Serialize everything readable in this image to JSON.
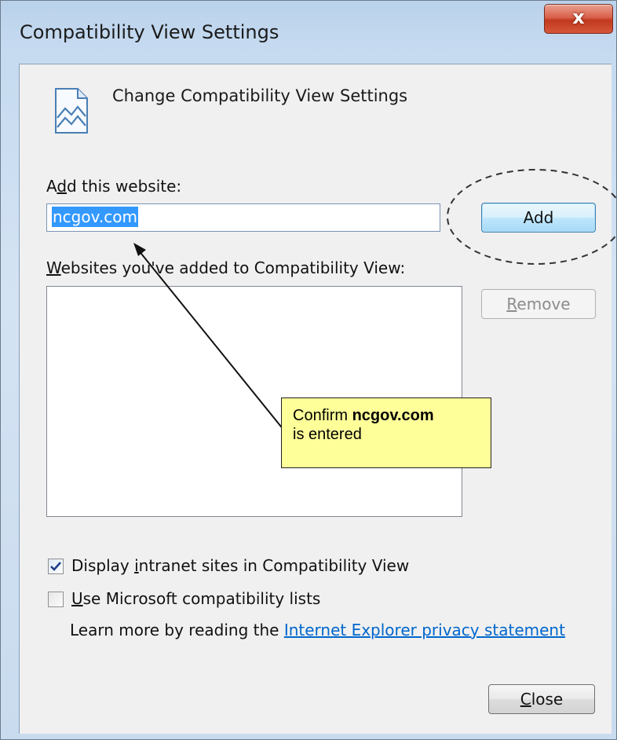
{
  "window": {
    "title": "Compatibility View Settings",
    "close_glyph": "x"
  },
  "header": {
    "icon": "compatibility-view-icon",
    "text": "Change Compatibility View Settings"
  },
  "add_section": {
    "label_pre": "A",
    "label_mnemonic": "d",
    "label_post": "d this website:",
    "input_value": "ncgov.com",
    "add_button": "Add"
  },
  "list_section": {
    "label_mnemonic": "W",
    "label_post": "ebsites you've added to Compatibility View:",
    "items": [],
    "remove_button_mnemonic": "R",
    "remove_button_post": "emove"
  },
  "options": {
    "display_intranet": {
      "checked": true,
      "label_pre": "Display ",
      "label_mnemonic": "i",
      "label_post": "ntranet sites in Compatibility View"
    },
    "use_ms_lists": {
      "checked": false,
      "label_mnemonic": "U",
      "label_post": "se Microsoft compatibility lists"
    }
  },
  "learn_more": {
    "text": "Learn more by reading the ",
    "link": "Internet Explorer privacy statement"
  },
  "footer": {
    "close_mnemonic": "C",
    "close_post": "lose"
  },
  "annotation": {
    "line1_pre": "Confirm ",
    "line1_bold": "ncgov.com",
    "line2": "is entered"
  },
  "colors": {
    "selection": "#3399ff",
    "callout_bg": "#ffff99",
    "link": "#0066cc",
    "close_button": "#c1391f"
  }
}
